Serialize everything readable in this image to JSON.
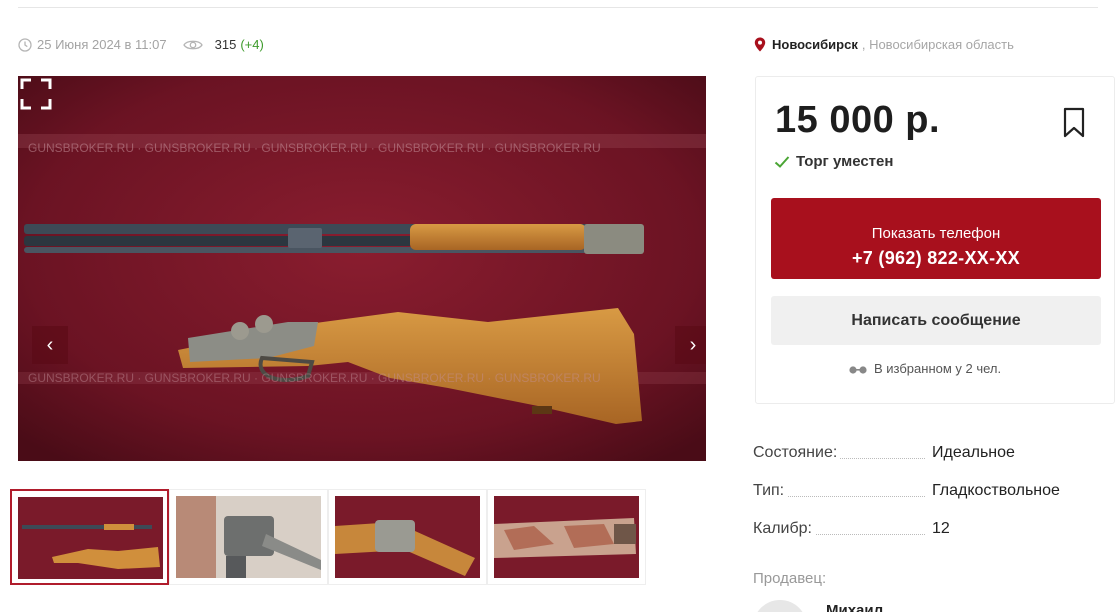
{
  "meta": {
    "date": "25 Июня 2024 в 11:07",
    "views": "315",
    "views_delta": "(+4)"
  },
  "location": {
    "city": "Новосибирск",
    "region": ", Новосибирская область"
  },
  "gallery": {
    "prev": "‹",
    "next": "›"
  },
  "offer": {
    "price": "15 000 р.",
    "haggle": "Торг уместен",
    "phone_label": "Показать телефон",
    "phone_number": "+7 (962) 822-XX-XX",
    "message_button": "Написать сообщение",
    "favorites": "В избранном у 2 чел."
  },
  "specs": [
    {
      "key": "Состояние:",
      "value": "Идеальное"
    },
    {
      "key": "Тип:",
      "value": "Гладкоствольное"
    },
    {
      "key": "Калибр:",
      "value": "12"
    }
  ],
  "seller": {
    "label": "Продавец:",
    "name": "Михаил"
  },
  "colors": {
    "accent": "#a8101d",
    "price_delta": "#3e9b2c",
    "thumb_active": "#b01c2c"
  },
  "icons": [
    "clock-icon",
    "eye-icon",
    "location-pin-icon",
    "bookmark-icon",
    "check-icon",
    "fullscreen-icon",
    "glasses-icon"
  ]
}
